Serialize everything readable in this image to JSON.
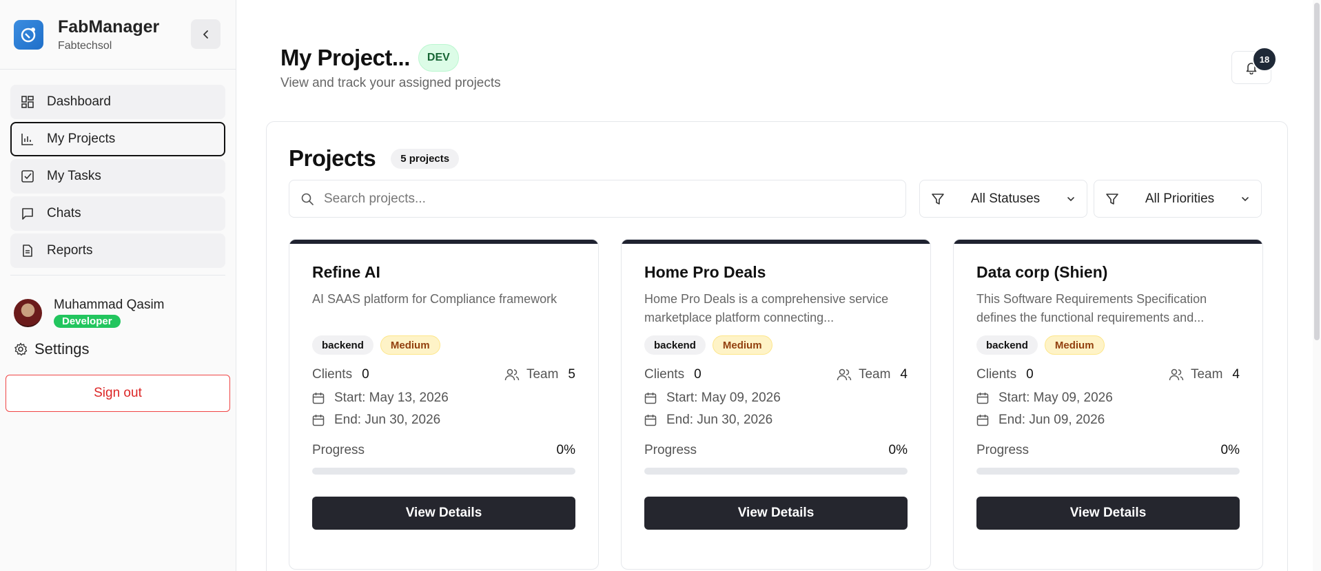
{
  "brand": {
    "title": "FabManager",
    "subtitle": "Fabtechsol"
  },
  "sidebar": {
    "items": [
      {
        "label": "Dashboard",
        "icon": "dashboard-icon"
      },
      {
        "label": "My Projects",
        "icon": "chart-icon"
      },
      {
        "label": "My Tasks",
        "icon": "checkbox-icon"
      },
      {
        "label": "Chats",
        "icon": "chat-icon"
      },
      {
        "label": "Reports",
        "icon": "document-icon"
      }
    ],
    "active_index": 1
  },
  "user": {
    "name": "Muhammad Qasim",
    "role": "Developer"
  },
  "settings_label": "Settings",
  "signout_label": "Sign out",
  "header": {
    "title": "My Project...",
    "env_badge": "DEV",
    "subtitle": "View and track your assigned projects",
    "notification_count": "18"
  },
  "projects": {
    "title": "Projects",
    "count_label": "5 projects",
    "search_placeholder": "Search projects...",
    "status_filter": "All Statuses",
    "priority_filter": "All Priorities",
    "cards": [
      {
        "name": "Refine AI",
        "description": "AI SAAS platform for Compliance framework",
        "tag": "backend",
        "priority": "Medium",
        "clients_label": "Clients",
        "clients": "0",
        "team_label": "Team",
        "team": "5",
        "start": "Start: May 13, 2026",
        "end": "End: Jun 30, 2026",
        "progress_label": "Progress",
        "progress_text": "0%",
        "progress": 0,
        "button": "View Details"
      },
      {
        "name": "Home Pro Deals",
        "description": "Home Pro Deals is a comprehensive service marketplace platform connecting...",
        "tag": "backend",
        "priority": "Medium",
        "clients_label": "Clients",
        "clients": "0",
        "team_label": "Team",
        "team": "4",
        "start": "Start: May 09, 2026",
        "end": "End: Jun 30, 2026",
        "progress_label": "Progress",
        "progress_text": "0%",
        "progress": 0,
        "button": "View Details"
      },
      {
        "name": "Data corp (Shien)",
        "description": "This Software Requirements Specification defines the functional requirements and...",
        "tag": "backend",
        "priority": "Medium",
        "clients_label": "Clients",
        "clients": "0",
        "team_label": "Team",
        "team": "4",
        "start": "Start: May 09, 2026",
        "end": "End: Jun 09, 2026",
        "progress_label": "Progress",
        "progress_text": "0%",
        "progress": 0,
        "button": "View Details"
      }
    ]
  },
  "colors": {
    "accent": "#1f2230",
    "developer_badge": "#22c55e",
    "signout": "#dc2626",
    "priority_bg": "#fef3c7"
  }
}
